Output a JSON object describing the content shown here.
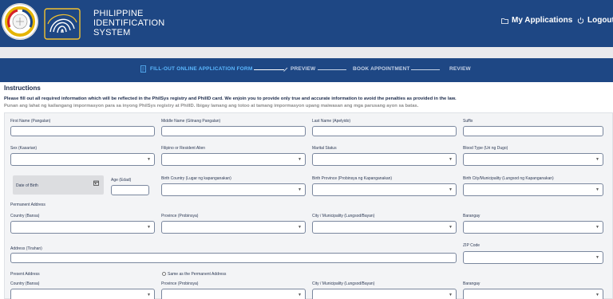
{
  "header": {
    "title_lines": [
      "PHILIPPINE",
      "IDENTIFICATION",
      "SYSTEM"
    ],
    "my_applications": "My Applications",
    "logout": "Logout",
    "colors": {
      "bar": "#1e4784",
      "active_step": "#5bb8ff"
    }
  },
  "stepper": {
    "steps": [
      "FILL-OUT ONLINE APPLICATION FORM",
      "PREVIEW",
      "BOOK APPOINTMENT",
      "REVIEW"
    ]
  },
  "instructions": {
    "title": "Instructions",
    "english": "Please fill out all required information which will be reflected in the PhilSys registry and PhilID card. We enjoin you to provide only true and accurate information to avoid the penalties as provided in the law.",
    "filipino": "Punan ang lahat ng kailangang impormasyon para sa inyong PhilSys registry at PhilID. Ibigay lamang ang totoo at tamang impormasyon upang maiwasan ang mga parusang ayon sa batas."
  },
  "form": {
    "first_name": "First Name (Pangalan)",
    "middle_name": "Middle Name (Gitnang Pangalan)",
    "last_name": "Last Name (Apelyido)",
    "suffix": "Suffix",
    "sex": "Sex (Kasarian)",
    "citizenship": "Filipino or Resident Alien",
    "marital_status": "Marital Status",
    "blood_type": "Blood Type (Uri ng Dugo)",
    "date_of_birth": "Date of Birth",
    "age": "Age (Edad)",
    "birth_country": "Birth Country (Lugar ng kapanganakan)",
    "birth_province": "Birth Province (Probinsya ng Kapanganakan)",
    "birth_city": "Birth City/Municipality (Lungsod ng Kapanganakan)",
    "permanent_address": "Permanent Address",
    "country": "Country (Bansa)",
    "province": "Province (Probinsya)",
    "city": "City / Municipality (Lungsod/Bayan)",
    "barangay": "Barangay",
    "address": "Address (Tirahan)",
    "zip": "ZIP Code",
    "present_address": "Present Address",
    "same_as_permanent": "Same as the Permanent Address",
    "country2": "Country (Bansa)",
    "province2": "Province (Probinsya)",
    "city2": "City / Municipality (Lungsod/Bayan)",
    "barangay2": "Barangay"
  }
}
